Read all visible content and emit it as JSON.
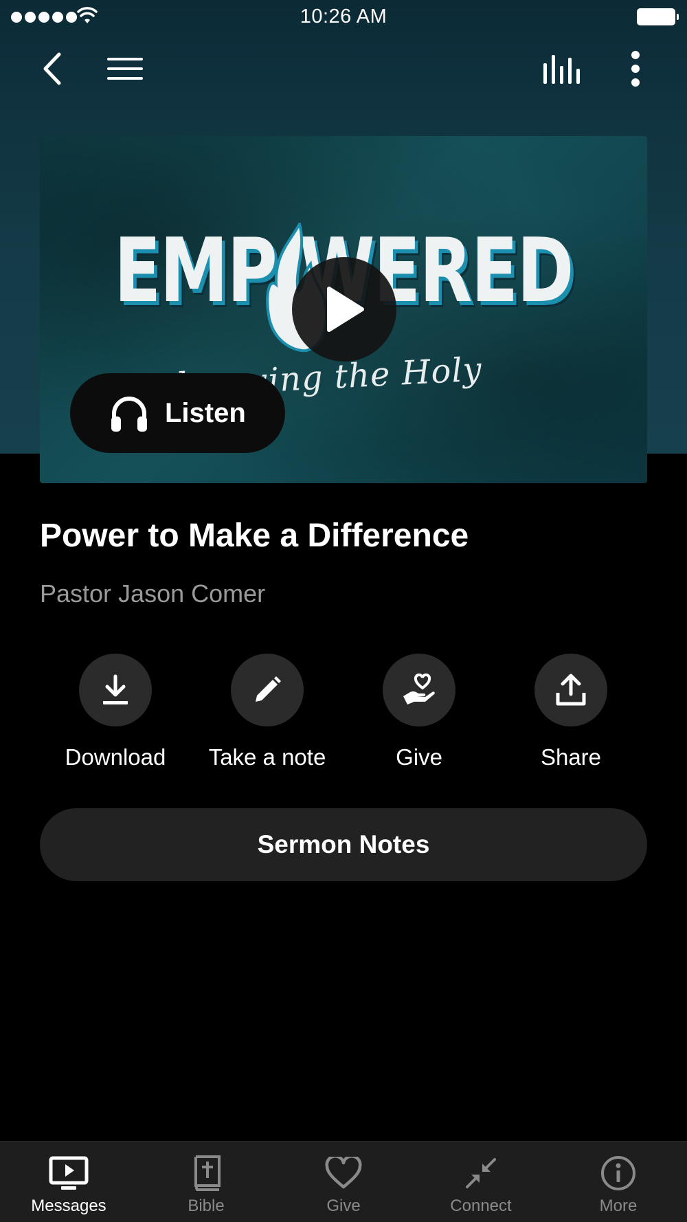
{
  "status_bar": {
    "time": "10:26 AM"
  },
  "artwork": {
    "title": "EMP WERED",
    "subtitle": "knowing the Holy Spirit"
  },
  "listen_button": {
    "label": "Listen"
  },
  "message": {
    "title": "Power to Make a Difference",
    "speaker": "Pastor Jason Comer"
  },
  "actions": [
    {
      "label": "Download",
      "icon": "download-icon"
    },
    {
      "label": "Take a note",
      "icon": "pencil-icon"
    },
    {
      "label": "Give",
      "icon": "hand-heart-icon"
    },
    {
      "label": "Share",
      "icon": "share-icon"
    }
  ],
  "sermon_notes": {
    "label": "Sermon Notes"
  },
  "tab_bar": {
    "active": "Messages",
    "tabs": [
      {
        "label": "Messages",
        "icon": "tv-play-icon"
      },
      {
        "label": "Bible",
        "icon": "bible-icon"
      },
      {
        "label": "Give",
        "icon": "heart-icon"
      },
      {
        "label": "Connect",
        "icon": "connect-arrows-icon"
      },
      {
        "label": "More",
        "icon": "info-icon"
      }
    ]
  },
  "colors": {
    "header_gradient_top": "#0b2a36",
    "header_gradient_bottom": "#16404c",
    "background": "#000000",
    "button_bg": "#2b2b2b",
    "tab_bar_bg": "#1e1e1e",
    "inactive_tab": "#8a8a8a",
    "artwork_accent": "#1d8fae"
  }
}
